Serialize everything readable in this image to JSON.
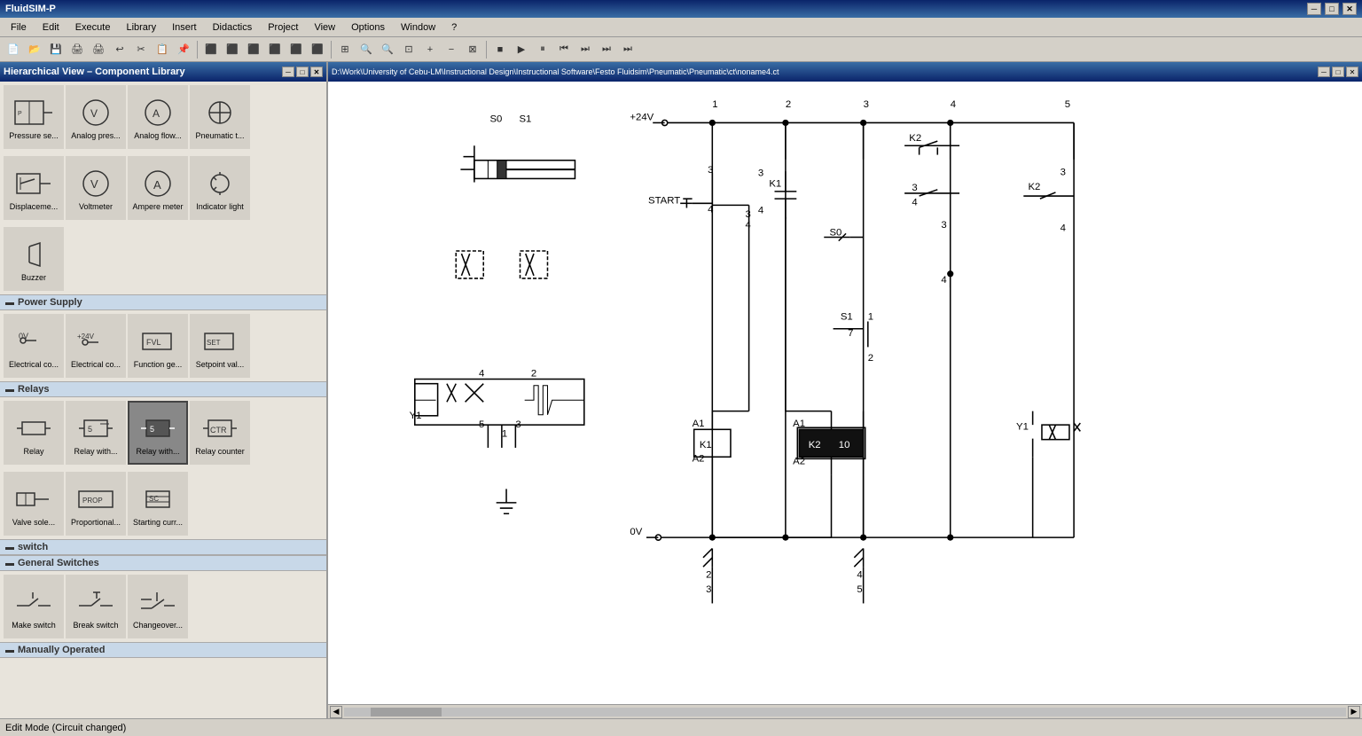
{
  "app": {
    "title": "FluidSIM-P",
    "title_icon": "fluid-sim-icon"
  },
  "title_bar": {
    "minimize_label": "─",
    "restore_label": "□",
    "close_label": "✕"
  },
  "menu": {
    "items": [
      "File",
      "Edit",
      "Execute",
      "Library",
      "Insert",
      "Didactics",
      "Project",
      "View",
      "Options",
      "Window",
      "?"
    ]
  },
  "toolbar": {
    "buttons": [
      {
        "name": "new",
        "icon": "📄"
      },
      {
        "name": "open",
        "icon": "📂"
      },
      {
        "name": "save",
        "icon": "💾"
      },
      {
        "name": "print-preview",
        "icon": "🖨"
      },
      {
        "name": "print",
        "icon": "🖨"
      },
      {
        "name": "undo",
        "icon": "↩"
      },
      {
        "name": "cut",
        "icon": "✂"
      },
      {
        "name": "copy",
        "icon": "📋"
      },
      {
        "name": "paste",
        "icon": "📌"
      },
      {
        "name": "sep1",
        "sep": true
      },
      {
        "name": "align1",
        "icon": "⬛"
      },
      {
        "name": "align2",
        "icon": "⬛"
      },
      {
        "name": "align3",
        "icon": "⬛"
      },
      {
        "name": "align4",
        "icon": "⬛"
      },
      {
        "name": "align5",
        "icon": "⬛"
      },
      {
        "name": "align6",
        "icon": "⬛"
      },
      {
        "name": "sep2",
        "sep": true
      },
      {
        "name": "table",
        "icon": "⊞"
      },
      {
        "name": "zoom-in",
        "icon": "🔍"
      },
      {
        "name": "zoom-out",
        "icon": "🔍"
      },
      {
        "name": "zoom-fit",
        "icon": "⊡"
      },
      {
        "name": "zoom-plus",
        "icon": "+"
      },
      {
        "name": "zoom-minus",
        "icon": "−"
      },
      {
        "name": "zoom-reset",
        "icon": "⊠"
      },
      {
        "name": "sep3",
        "sep": true
      },
      {
        "name": "run-stop",
        "icon": "■"
      },
      {
        "name": "run-play",
        "icon": "▶"
      },
      {
        "name": "run-pause",
        "icon": "⏸"
      },
      {
        "name": "run-back",
        "icon": "⏮"
      },
      {
        "name": "run-fwd",
        "icon": "⏭"
      },
      {
        "name": "run-end",
        "icon": "⏭"
      },
      {
        "name": "run-last",
        "icon": "⏭"
      }
    ]
  },
  "library": {
    "title": "Hierarchical View – Component Library",
    "sections": [
      {
        "name": "sensors",
        "items": [
          {
            "label": "Pressure se...",
            "icon": "pressure-sensor"
          },
          {
            "label": "Analog pres...",
            "icon": "analog-pressure"
          },
          {
            "label": "Analog flow...",
            "icon": "analog-flow"
          },
          {
            "label": "Pneumatic t...",
            "icon": "pneumatic-t"
          }
        ]
      },
      {
        "name": "meters",
        "items": [
          {
            "label": "Displaceme...",
            "icon": "displacement"
          },
          {
            "label": "Voltmeter",
            "icon": "voltmeter"
          },
          {
            "label": "Ampere meter",
            "icon": "ampere-meter"
          },
          {
            "label": "Indicator light",
            "icon": "indicator-light"
          }
        ]
      },
      {
        "name": "buzzer-row",
        "items": [
          {
            "label": "Buzzer",
            "icon": "buzzer"
          }
        ]
      },
      {
        "name": "power-supply",
        "title": "Power Supply",
        "items": [
          {
            "label": "Electrical co...",
            "icon": "electrical-0v",
            "sublabel": "0V"
          },
          {
            "label": "Electrical co...",
            "icon": "electrical-24v",
            "sublabel": "+24V"
          },
          {
            "label": "Function ge...",
            "icon": "function-gen"
          },
          {
            "label": "Setpoint val...",
            "icon": "setpoint-val"
          }
        ]
      },
      {
        "name": "relays",
        "title": "Relays",
        "items": [
          {
            "label": "Relay",
            "icon": "relay"
          },
          {
            "label": "Relay with...",
            "icon": "relay-with-1"
          },
          {
            "label": "Relay with...",
            "icon": "relay-with-2",
            "selected": true
          },
          {
            "label": "Relay counter",
            "icon": "relay-counter"
          }
        ]
      },
      {
        "name": "valves",
        "items": [
          {
            "label": "Valve sole...",
            "icon": "valve-solenoid"
          },
          {
            "label": "Proportional...",
            "icon": "proportional"
          },
          {
            "label": "Starting curr...",
            "icon": "starting-current"
          }
        ]
      },
      {
        "name": "switch",
        "title": "switch",
        "items": []
      },
      {
        "name": "general-switches",
        "title": "General Switches",
        "items": [
          {
            "label": "Make switch",
            "icon": "make-switch"
          },
          {
            "label": "Break switch",
            "icon": "break-switch"
          },
          {
            "label": "Changeover...",
            "icon": "changeover"
          }
        ]
      },
      {
        "name": "manually-operated",
        "title": "Manually Operated",
        "items": []
      }
    ]
  },
  "diagram": {
    "title": "D:\\Work\\University of Cebu-LM\\Instructional Design\\Instructional Software\\Festo Fluidsim\\Pneumatic\\Pneumatic\\ct\\noname4.ct",
    "labels": {
      "voltage_pos": "+24V",
      "voltage_neg": "0V",
      "start": "START",
      "k1": "K1",
      "k2": "K2",
      "s0": "S0",
      "s1": "S1",
      "y1": "Y1",
      "columns": [
        "1",
        "2",
        "3",
        "4",
        "5"
      ],
      "timer_value": "10"
    }
  },
  "status_bar": {
    "text": "Edit Mode (Circuit changed)"
  },
  "scrollbar": {
    "h_scroll": "horizontal-scrollbar",
    "v_scroll": "vertical-scrollbar"
  }
}
